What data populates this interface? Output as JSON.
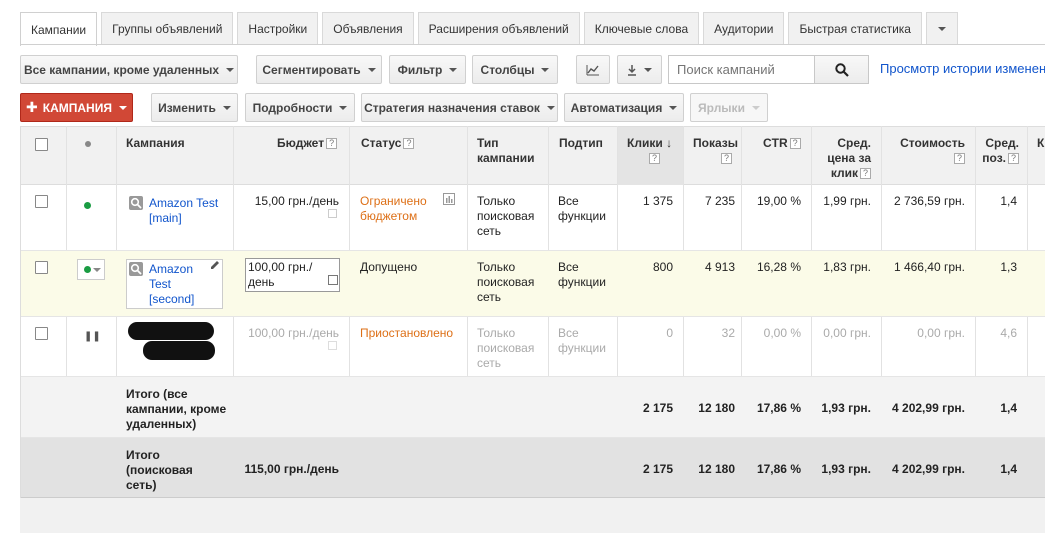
{
  "tabs": [
    "Кампании",
    "Группы объявлений",
    "Настройки",
    "Объявления",
    "Расширения объявлений",
    "Ключевые слова",
    "Аудитории",
    "Быстрая статистика"
  ],
  "toolbar1": {
    "filter_campaigns": "Все кампании, кроме удаленных",
    "segment": "Сегментировать",
    "filter": "Фильтр",
    "columns": "Столбцы",
    "search_placeholder": "Поиск кампаний",
    "history_link": "Просмотр истории изменений"
  },
  "toolbar2": {
    "campaign_btn": "КАМПАНИЯ",
    "edit": "Изменить",
    "details": "Подробности",
    "bid_strategy": "Стратегия назначения ставок",
    "automation": "Автоматизация",
    "labels": "Ярлыки"
  },
  "headers": {
    "campaign": "Кампания",
    "budget": "Бюджет",
    "status": "Статус",
    "type": "Тип кампании",
    "subtype": "Подтип",
    "clicks": "Клики",
    "impressions": "Показы",
    "ctr": "CTR",
    "avg_cpc": "Сред. цена за клик",
    "cost": "Стоимость",
    "avg_pos": "Сред. поз."
  },
  "rows": [
    {
      "name": "Amazon Test [main]",
      "budget": "15,00 грн./день",
      "status": "Ограничено бюджетом",
      "type": "Только поисковая сеть",
      "subtype": "Все функции",
      "clicks": "1 375",
      "impressions": "7 235",
      "ctr": "19,00 %",
      "cpc": "1,99 грн.",
      "cost": "2 736,59 грн.",
      "pos": "1,4"
    },
    {
      "name": "Amazon Test [second]",
      "budget": "100,00 грн./день",
      "status": "Допущено",
      "type": "Только поисковая сеть",
      "subtype": "Все функции",
      "clicks": "800",
      "impressions": "4 913",
      "ctr": "16,28 %",
      "cpc": "1,83 грн.",
      "cost": "1 466,40 грн.",
      "pos": "1,3"
    },
    {
      "name": "",
      "budget": "100,00 грн./день",
      "status": "Приостановлено",
      "type": "Только поисковая сеть",
      "subtype": "Все функции",
      "clicks": "0",
      "impressions": "32",
      "ctr": "0,00 %",
      "cpc": "0,00 грн.",
      "cost": "0,00 грн.",
      "pos": "4,6"
    }
  ],
  "totals": [
    {
      "label": "Итого (все кампании, кроме удаленных)",
      "budget": "",
      "clicks": "2 175",
      "impressions": "12 180",
      "ctr": "17,86 %",
      "cpc": "1,93 грн.",
      "cost": "4 202,99 грн.",
      "pos": "1,4"
    },
    {
      "label": "Итого (поисковая сеть)",
      "budget": "115,00 грн./день",
      "clicks": "2 175",
      "impressions": "12 180",
      "ctr": "17,86 %",
      "cpc": "1,93 грн.",
      "cost": "4 202,99 грн.",
      "pos": "1,4"
    }
  ],
  "colors": {
    "accent_red": "#d14836",
    "link": "#1155cc",
    "status_orange": "#dd6f16",
    "enabled_green": "#1a9c43"
  }
}
